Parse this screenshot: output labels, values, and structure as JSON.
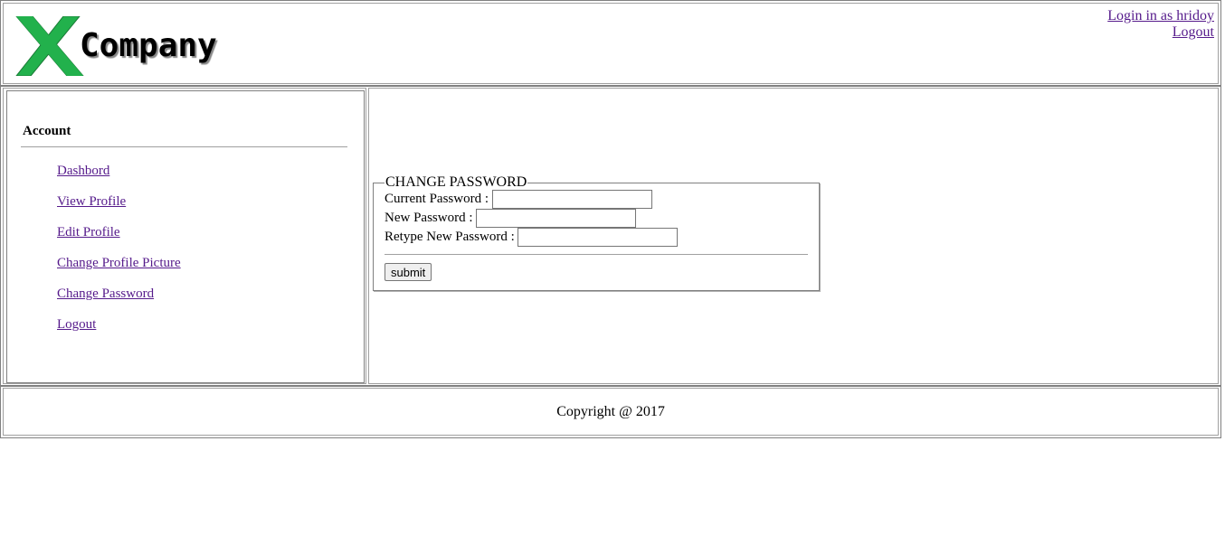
{
  "header": {
    "logo_text": "Company",
    "login_status": "Login in as hridoy",
    "logout_label": "Logout"
  },
  "sidebar": {
    "title": "Account",
    "items": [
      {
        "label": "Dashbord"
      },
      {
        "label": "View Profile"
      },
      {
        "label": "Edit Profile"
      },
      {
        "label": "Change Profile Picture"
      },
      {
        "label": "Change Password"
      },
      {
        "label": "Logout"
      }
    ]
  },
  "form": {
    "legend": "CHANGE PASSWORD",
    "current_password_label": "Current Password :",
    "current_password_value": "",
    "new_password_label": "New Password :",
    "new_password_value": "",
    "retype_password_label": "Retype New Password :",
    "retype_password_value": "",
    "submit_label": "submit"
  },
  "footer": {
    "copyright": "Copyright @ 2017"
  },
  "colors": {
    "logo_green": "#22b14c",
    "link": "#551a8b",
    "border": "#808080"
  }
}
